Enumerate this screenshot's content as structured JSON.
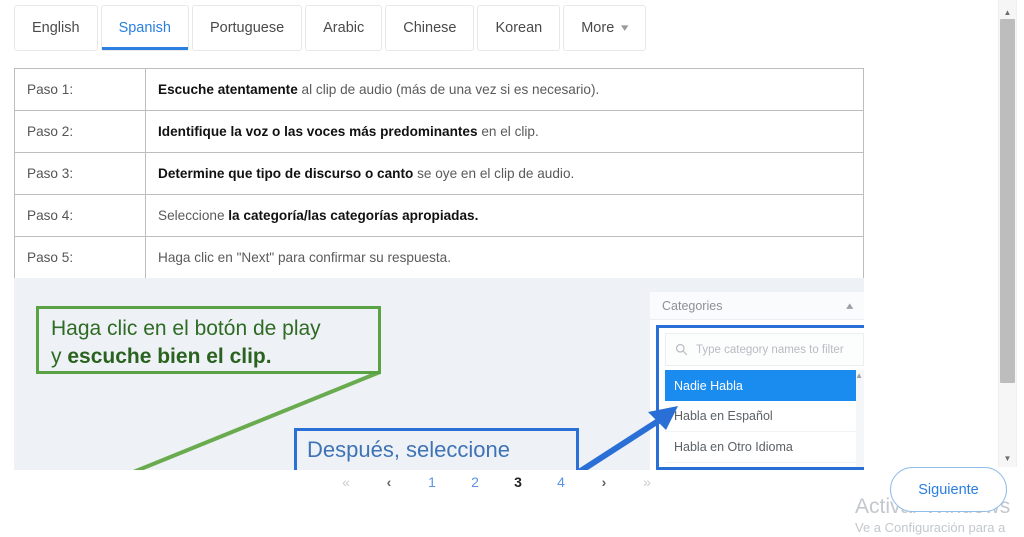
{
  "tabs": [
    {
      "label": "English",
      "active": false
    },
    {
      "label": "Spanish",
      "active": true
    },
    {
      "label": "Portuguese",
      "active": false
    },
    {
      "label": "Arabic",
      "active": false
    },
    {
      "label": "Chinese",
      "active": false
    },
    {
      "label": "Korean",
      "active": false
    },
    {
      "label": "More",
      "active": false,
      "icon": "chevron-down-icon"
    }
  ],
  "steps_table": {
    "rows": [
      {
        "step": "Paso 1:",
        "bold": "Escuche atentamente",
        "rest": " al clip de audio (más de una vez si es necesario).",
        "bold_first": true
      },
      {
        "step": "Paso 2:",
        "bold": "Identifique la voz o las voces más predominantes",
        "rest": " en el clip.",
        "bold_first": true
      },
      {
        "step": "Paso 3:",
        "bold": "Determine que tipo de discurso o canto",
        "rest": " se oye en el clip de audio.",
        "bold_first": true
      },
      {
        "step": "Paso 4:",
        "lead": "Seleccione ",
        "bold": "la categoría/las categorías apropiadas.",
        "rest": "",
        "bold_first": false
      },
      {
        "step": "Paso 5:",
        "lead": "Haga clic en \"Next\" para confirmar su respuesta.",
        "bold": "",
        "rest": "",
        "bold_first": false
      }
    ]
  },
  "illustration": {
    "green_callout": {
      "line1": "Haga clic en el botón de play",
      "line2_lead": "y ",
      "line2_bold": "escuche bien el clip.",
      "border_color": "#5aa345",
      "text_color": "#2f6b24"
    },
    "blue_callout": {
      "text": "Después, seleccione",
      "border_color": "#2a6fd6",
      "text_color": "#3f73b5"
    },
    "categories_panel": {
      "title": "Categories",
      "collapse_icon": "chevron-up-icon",
      "search_placeholder": "Type category names to filter",
      "search_icon": "search-icon",
      "items": [
        {
          "label": "Nadie Habla",
          "selected": true
        },
        {
          "label": "Habla en Español",
          "selected": false
        },
        {
          "label": "Habla en Otro Idioma",
          "selected": false
        },
        {
          "label": "",
          "selected": false,
          "partial": true
        }
      ],
      "selected_color": "#1a8cf0",
      "highlight_border": "#2a6fd6"
    }
  },
  "pagination": {
    "first_label": "«",
    "prev_label": "‹",
    "pages": [
      "1",
      "2",
      "3",
      "4"
    ],
    "current": "3",
    "next_label": "›",
    "last_label": "»"
  },
  "footer": {
    "siguiente_label": "Siguiente"
  },
  "watermark": {
    "title": "Activar Windows",
    "subtitle": "Ve a Configuración para a"
  },
  "scrollbar": {
    "up_icon": "triangle-up-icon",
    "down_icon": "triangle-down-icon"
  }
}
